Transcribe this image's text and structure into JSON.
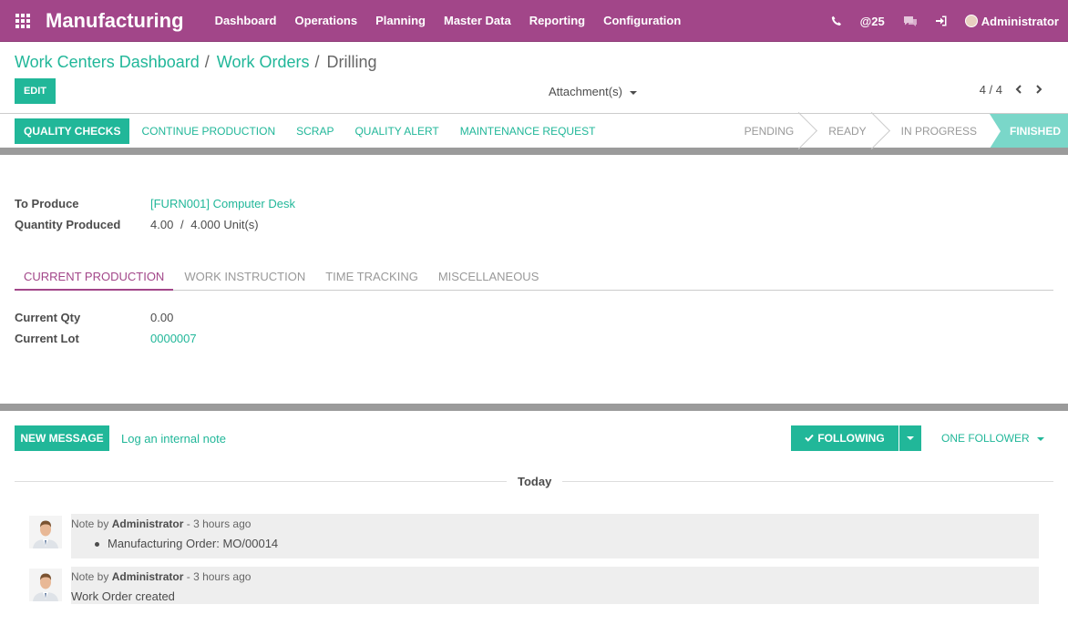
{
  "app": {
    "title": "Manufacturing"
  },
  "menu": [
    "Dashboard",
    "Operations",
    "Planning",
    "Master Data",
    "Reporting",
    "Configuration"
  ],
  "topright": {
    "mentions": "@25",
    "user": "Administrator"
  },
  "breadcrumb": {
    "first": "Work Centers Dashboard",
    "second": "Work Orders",
    "current": "Drilling",
    "sep": "/"
  },
  "toolbar": {
    "edit_label": "EDIT",
    "attachments_label": "Attachment(s)",
    "pager": "4 / 4"
  },
  "actions": {
    "quality_checks": "QUALITY CHECKS",
    "continue_production": "CONTINUE PRODUCTION",
    "scrap": "SCRAP",
    "quality_alert": "QUALITY ALERT",
    "maintenance_request": "MAINTENANCE REQUEST"
  },
  "status": {
    "pending": "PENDING",
    "ready": "READY",
    "in_progress": "IN PROGRESS",
    "finished": "FINISHED"
  },
  "form": {
    "to_produce_label": "To Produce",
    "to_produce_value": "[FURN001] Computer Desk",
    "qty_produced_label": "Quantity Produced",
    "qty_produced_value": "4.00",
    "qty_sep": "/",
    "qty_total": "4.000",
    "qty_unit": "Unit(s)"
  },
  "tabs": {
    "current_production": "CURRENT PRODUCTION",
    "work_instruction": "WORK INSTRUCTION",
    "time_tracking": "TIME TRACKING",
    "miscellaneous": "MISCELLANEOUS"
  },
  "current": {
    "qty_label": "Current Qty",
    "qty_value": "0.00",
    "lot_label": "Current Lot",
    "lot_value": "0000007"
  },
  "chatter": {
    "new_message": "NEW MESSAGE",
    "log_note": "Log an internal note",
    "following": "FOLLOWING",
    "followers": "ONE FOLLOWER",
    "today": "Today",
    "messages": [
      {
        "prefix": "Note by",
        "author": "Administrator",
        "time": "- 3 hours ago",
        "text": "Manufacturing Order: MO/00014",
        "bullet": true
      },
      {
        "prefix": "Note by",
        "author": "Administrator",
        "time": "- 3 hours ago",
        "text": "Work Order created",
        "bullet": false
      }
    ]
  }
}
